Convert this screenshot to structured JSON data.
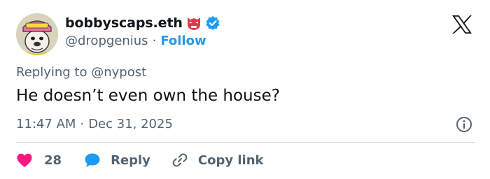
{
  "author": {
    "display_name": "bobbyscaps.eth",
    "handle": "@dropgenius",
    "follow_label": "Follow",
    "separator": "·",
    "name_emoji": "red-mask-emoji",
    "verified_icon": "verified-badge-icon",
    "avatar_icon": "bulldog-avatar"
  },
  "platform_logo": "x-logo-icon",
  "reply_context": {
    "prefix": "Replying to",
    "mention": "@nypost"
  },
  "tweet": {
    "text": "He doesn’t even own the house?",
    "time": "11:47 AM",
    "separator": "·",
    "date": "Dec 31, 2025",
    "info_icon": "info-icon"
  },
  "actions": {
    "like_count": "28",
    "reply_label": "Reply",
    "copy_label": "Copy link"
  },
  "colors": {
    "accent": "#1d9bf0",
    "like": "#f91880",
    "text_primary": "#0f1419",
    "text_secondary": "#536471",
    "divider": "#cfd9de"
  }
}
